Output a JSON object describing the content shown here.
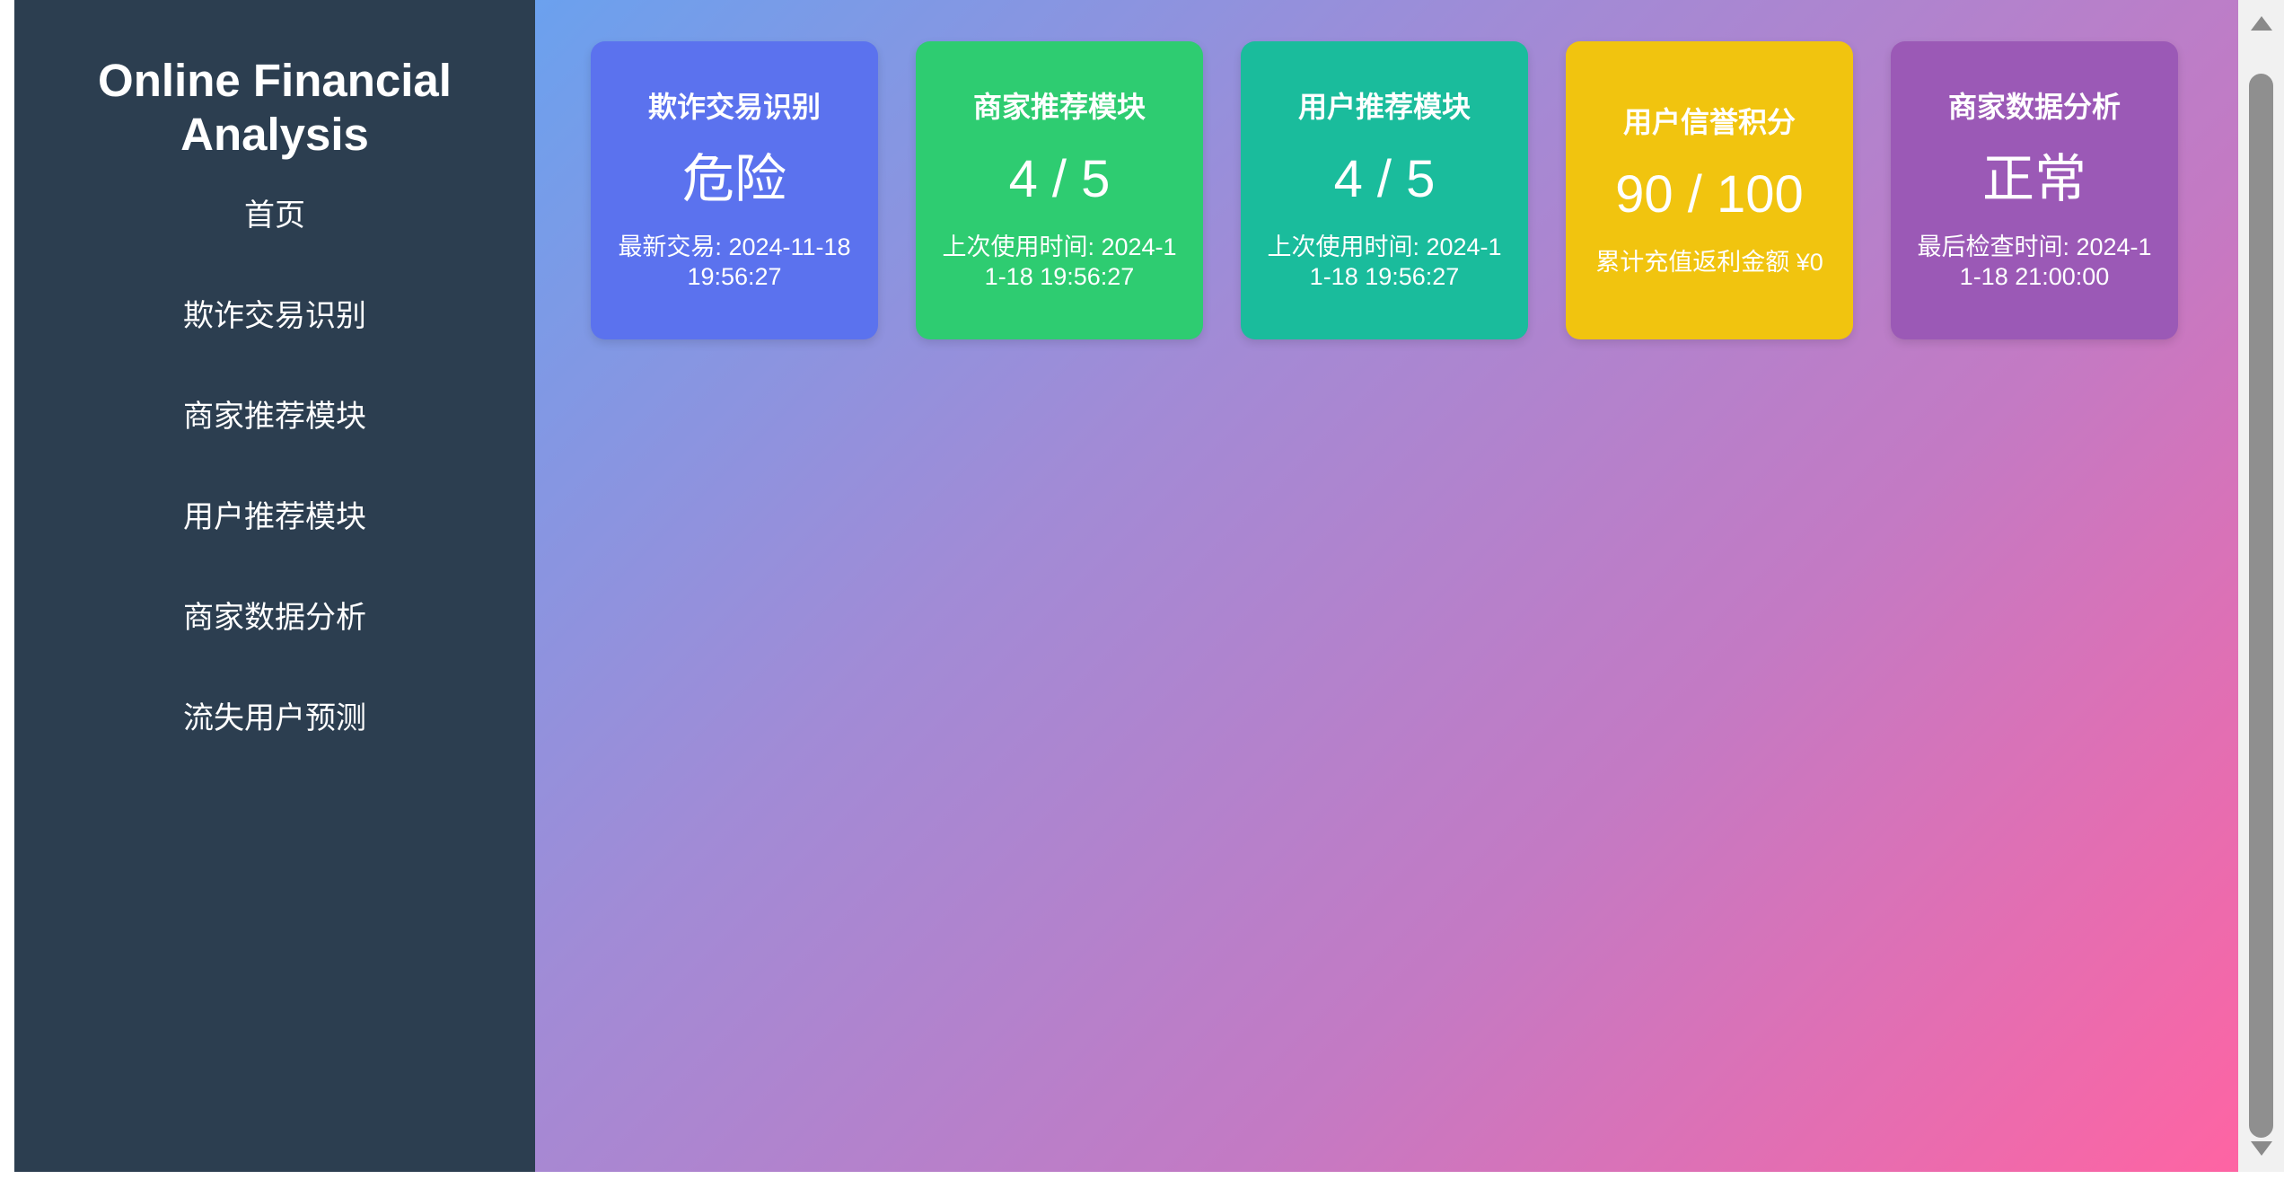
{
  "sidebar": {
    "title": "Online Financial Analysis",
    "items": [
      {
        "label": "首页"
      },
      {
        "label": "欺诈交易识别"
      },
      {
        "label": "商家推荐模块"
      },
      {
        "label": "用户推荐模块"
      },
      {
        "label": "商家数据分析"
      },
      {
        "label": "流失用户预测"
      }
    ]
  },
  "cards": [
    {
      "title": "欺诈交易识别",
      "value": "危险",
      "desc": "最新交易: 2024-11-18 19:56:27",
      "color": "#5b72ee"
    },
    {
      "title": "商家推荐模块",
      "value": "4 / 5",
      "desc": "上次使用时间: 2024-11-18 19:56:27",
      "color": "#2ecc71"
    },
    {
      "title": "用户推荐模块",
      "value": "4 / 5",
      "desc": "上次使用时间: 2024-11-18 19:56:27",
      "color": "#1abc9c"
    },
    {
      "title": "用户信誉积分",
      "value": "90 / 100",
      "desc": "累计充值返利金额 ¥0",
      "color": "#f1c40f"
    },
    {
      "title": "商家数据分析",
      "value": "正常",
      "desc": "最后检查时间: 2024-11-18 21:00:00",
      "color": "#9b59b6"
    }
  ],
  "colors": {
    "sidebar_bg": "#2c3e50",
    "gradient_start": "#6ba1ee",
    "gradient_end": "#fe64a3"
  },
  "icons": {
    "scroll_up": "scroll-up-arrow-icon",
    "scroll_down": "scroll-down-arrow-icon"
  }
}
